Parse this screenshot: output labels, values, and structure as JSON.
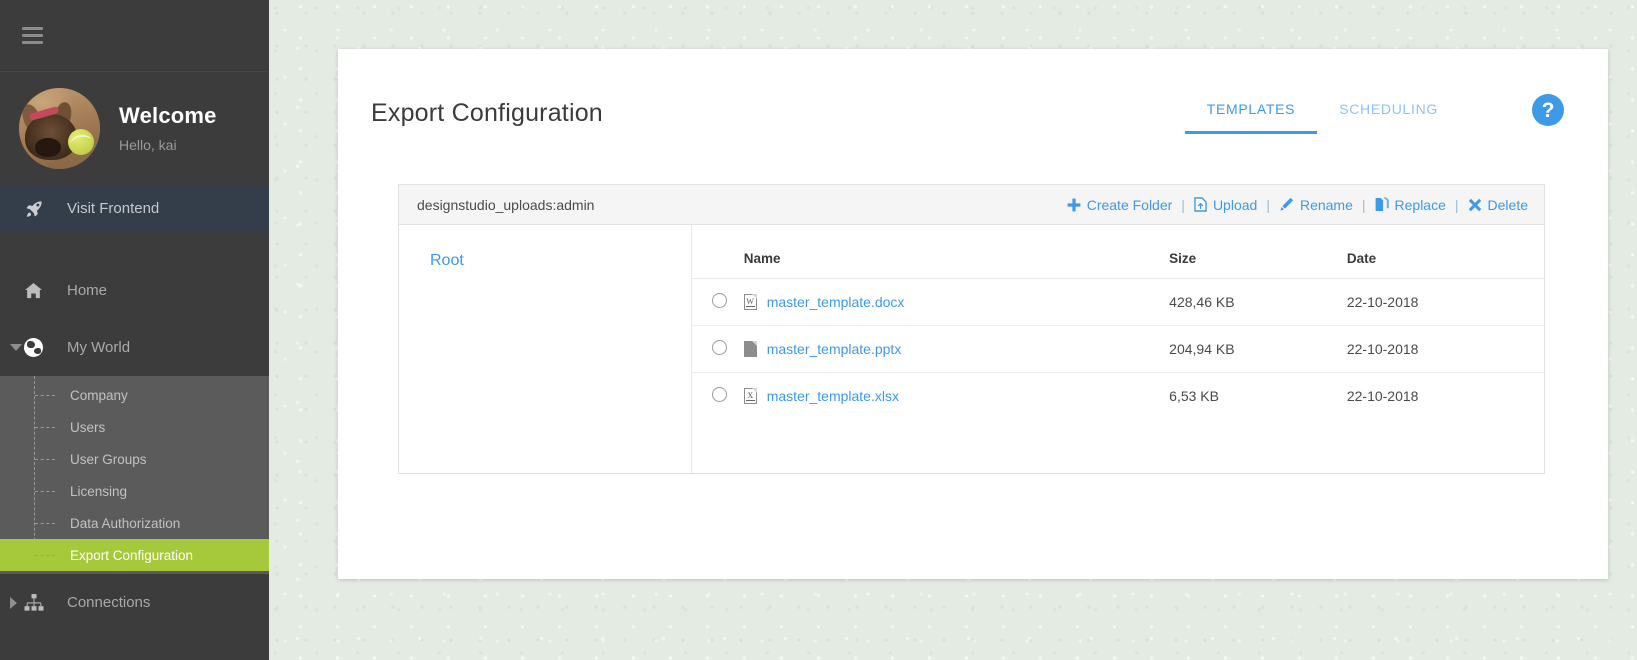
{
  "sidebar": {
    "menu_icon": "hamburger-icon",
    "profile": {
      "avatar_alt": "dog-avatar",
      "title": "Welcome",
      "subtitle": "Hello, kai"
    },
    "visit_frontend": {
      "label": "Visit Frontend",
      "icon": "rocket-icon"
    },
    "items": [
      {
        "label": "Home",
        "icon": "home-icon",
        "state": "default"
      },
      {
        "label": "My World",
        "icon": "globe-icon",
        "state": "expanded"
      },
      {
        "label": "Connections",
        "icon": "sitemap-icon",
        "state": "collapsed"
      }
    ],
    "submenu": [
      {
        "label": "Company",
        "active": false
      },
      {
        "label": "Users",
        "active": false
      },
      {
        "label": "User Groups",
        "active": false
      },
      {
        "label": "Licensing",
        "active": false
      },
      {
        "label": "Data Authorization",
        "active": false
      },
      {
        "label": "Export Configuration",
        "active": true
      }
    ],
    "colors": {
      "background": "#3c3c3c",
      "submenu_background": "#5b5b5b",
      "active": "#a5c93a",
      "frontend_bar": "#333e4a"
    }
  },
  "header": {
    "title": "Export Configuration",
    "tabs": [
      {
        "label": "TEMPLATES",
        "active": true
      },
      {
        "label": "SCHEDULING",
        "active": false
      }
    ],
    "help_label": "?",
    "accent_color": "#3d9ae8"
  },
  "file_manager": {
    "path": "designstudio_uploads:admin",
    "actions": [
      {
        "label": "Create Folder",
        "icon": "plus-icon"
      },
      {
        "label": "Upload",
        "icon": "upload-icon"
      },
      {
        "label": "Rename",
        "icon": "pencil-icon"
      },
      {
        "label": "Replace",
        "icon": "copy-file-icon"
      },
      {
        "label": "Delete",
        "icon": "close-x-icon"
      }
    ],
    "separator": "|",
    "tree": {
      "root_label": "Root"
    },
    "columns": [
      "Name",
      "Size",
      "Date"
    ],
    "rows": [
      {
        "name": "master_template.docx",
        "size": "428,46 KB",
        "date": "22-10-2018",
        "icon": "word-file-icon",
        "selected": false
      },
      {
        "name": "master_template.pptx",
        "size": "204,94 KB",
        "date": "22-10-2018",
        "icon": "generic-file-icon",
        "selected": false
      },
      {
        "name": "master_template.xlsx",
        "size": "6,53 KB",
        "date": "22-10-2018",
        "icon": "excel-file-icon",
        "selected": false
      }
    ]
  }
}
